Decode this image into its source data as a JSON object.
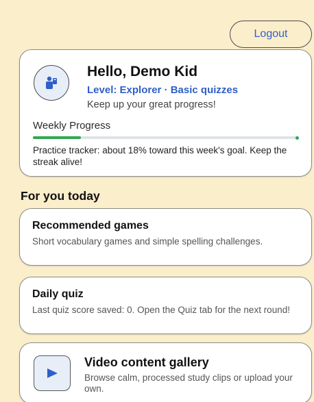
{
  "header": {
    "logout_label": "Logout"
  },
  "profile": {
    "avatar_icon": "kid-avatar-icon",
    "greeting": "Hello, Demo Kid",
    "level": "Level: Explorer · Basic quizzes",
    "subtitle": "Keep up your great progress!",
    "progress_label": "Weekly Progress",
    "progress_fraction": 0.18,
    "tracker_note": "Practice tracker: about 18% toward this week's goal. Keep the streak alive!"
  },
  "section": {
    "title": "For you today"
  },
  "cards": {
    "games": {
      "title": "Recommended games",
      "description": "Short vocabulary games and simple spelling challenges."
    },
    "quiz": {
      "title": "Daily quiz",
      "description": "Last quiz score saved: 0. Open the Quiz tab for the next round!"
    },
    "video": {
      "icon": "play-icon",
      "title": "Video content gallery",
      "description": "Browse calm, processed study clips or upload your own."
    }
  },
  "colors": {
    "background": "#fbeecb",
    "accent_blue": "#2f5fc7",
    "progress_green": "#2fa84f"
  }
}
